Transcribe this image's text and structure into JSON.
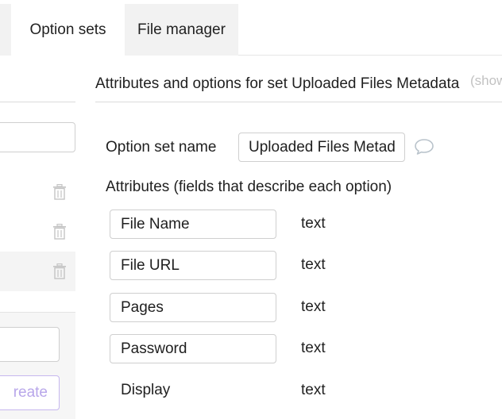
{
  "tabs": {
    "option_sets": "Option sets",
    "file_manager": "File manager"
  },
  "left_panel": {
    "create_label": "reate"
  },
  "panel": {
    "header": "Attributes and options for set Uploaded Files Metadata",
    "show_link": "(show"
  },
  "form": {
    "name_label": "Option set name",
    "name_value": "Uploaded Files Metadat",
    "attributes_heading": "Attributes (fields that describe each option)"
  },
  "attributes": [
    {
      "name": "File Name",
      "type": "text"
    },
    {
      "name": "File URL",
      "type": "text"
    },
    {
      "name": "Pages",
      "type": "text"
    },
    {
      "name": "Password",
      "type": "text"
    },
    {
      "name": "Display",
      "type": "text"
    }
  ],
  "colors": {
    "accent_light": "#c6b7ef",
    "tab_inactive_bg": "#f2f2f2"
  }
}
